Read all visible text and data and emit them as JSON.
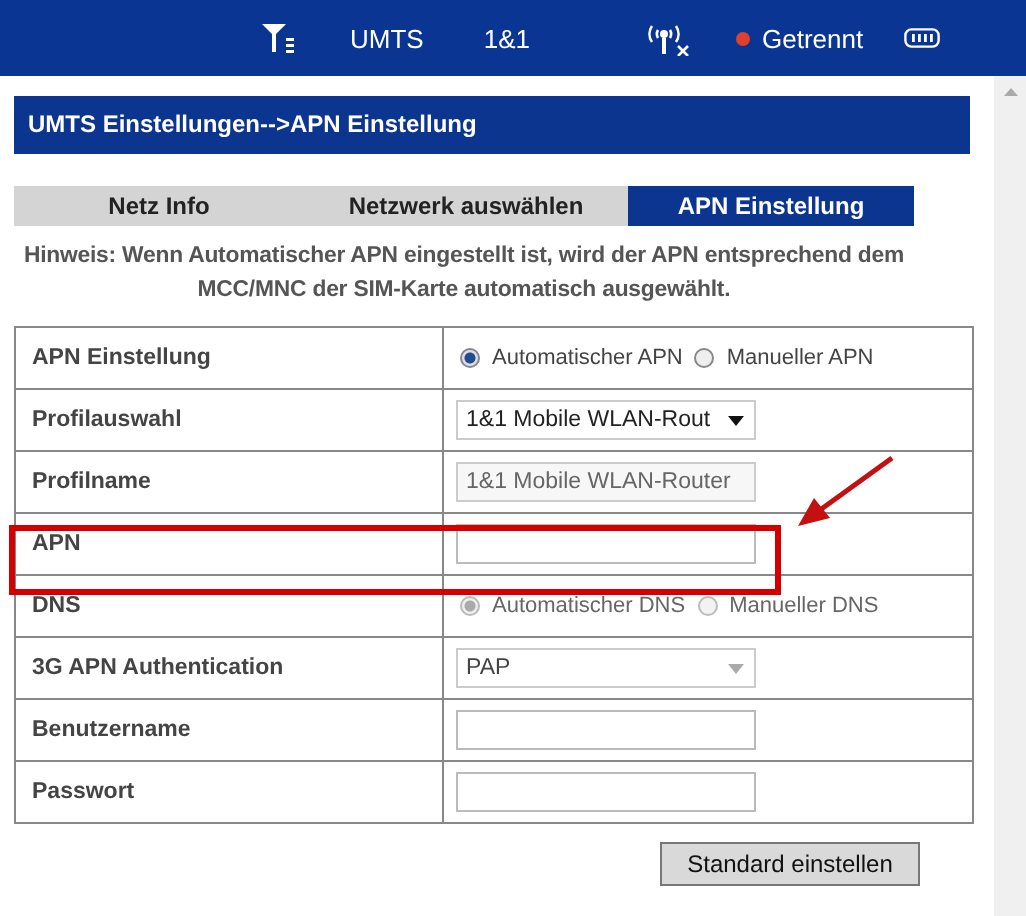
{
  "status_bar": {
    "network_type": "UMTS",
    "provider": "1&1",
    "connection": {
      "label": "Getrennt",
      "color": "#e0402a"
    }
  },
  "header": {
    "title": "UMTS Einstellungen-->APN Einstellung"
  },
  "tabs": [
    {
      "label": "Netz Info",
      "selected": false
    },
    {
      "label": "Netzwerk auswählen",
      "selected": false
    },
    {
      "label": "APN Einstellung",
      "selected": true
    }
  ],
  "hint": "Hinweis: Wenn Automatischer APN eingestellt ist, wird der APN entsprechend dem MCC/MNC der SIM-Karte automatisch ausgewählt.",
  "form": [
    {
      "label": "APN Einstellung",
      "kind": "radio",
      "disabled": false,
      "options": [
        {
          "label": "Automatischer APN",
          "selected": true
        },
        {
          "label": "Manueller APN",
          "selected": false
        }
      ]
    },
    {
      "label": "Profilauswahl",
      "kind": "select",
      "disabled": false,
      "value": "1&1 Mobile WLAN-Rout"
    },
    {
      "label": "Profilname",
      "kind": "input",
      "disabled": true,
      "value": "1&1 Mobile WLAN-Router"
    },
    {
      "label": "APN",
      "kind": "input",
      "disabled": false
    },
    {
      "label": "DNS",
      "kind": "radio",
      "disabled": true,
      "options": [
        {
          "label": "Automatischer DNS",
          "selected": true
        },
        {
          "label": "Manueller DNS",
          "selected": false
        }
      ]
    },
    {
      "label": "3G APN Authentication",
      "kind": "select",
      "disabled": true,
      "value": "PAP"
    },
    {
      "label": "Benutzername",
      "kind": "input",
      "disabled": false
    },
    {
      "label": "Passwort",
      "kind": "input",
      "disabled": false
    }
  ],
  "buttons": [
    "Standard einstellen"
  ]
}
